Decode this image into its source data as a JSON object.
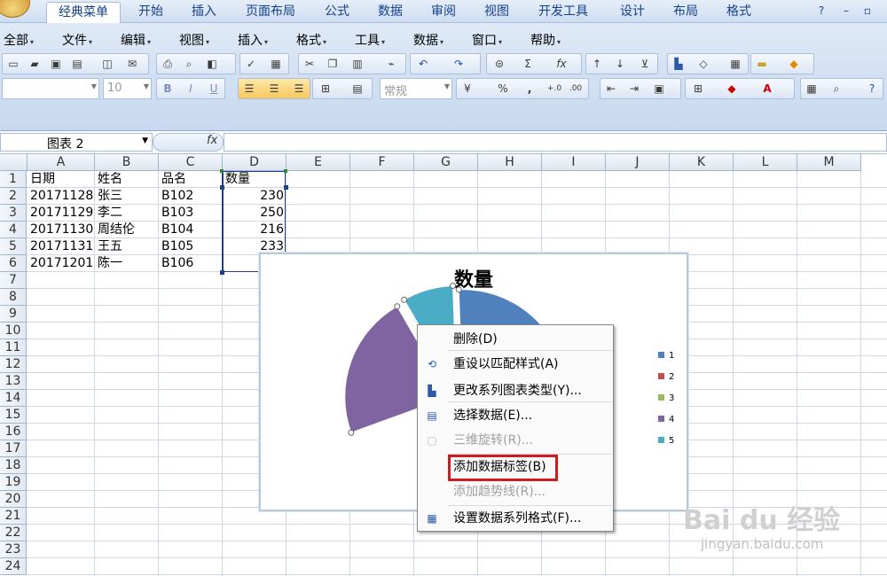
{
  "tabs": [
    {
      "label": "经典菜单",
      "active": true
    },
    {
      "label": "开始"
    },
    {
      "label": "插入"
    },
    {
      "label": "页面布局"
    },
    {
      "label": "公式"
    },
    {
      "label": "数据"
    },
    {
      "label": "审阅"
    },
    {
      "label": "视图"
    },
    {
      "label": "开发工具"
    },
    {
      "label": "设计"
    },
    {
      "label": "布局"
    },
    {
      "label": "格式"
    }
  ],
  "menubar": [
    "全部",
    "文件",
    "编辑",
    "视图",
    "插入",
    "格式",
    "工具",
    "数据",
    "窗口",
    "帮助"
  ],
  "toolbar": {
    "font_size": "10",
    "number_format": "常规"
  },
  "formula_bar": {
    "name_box": "图表 2",
    "fx": "fx",
    "value": ""
  },
  "columns": [
    "A",
    "B",
    "C",
    "D",
    "E",
    "F",
    "G",
    "H",
    "I",
    "J",
    "K",
    "L",
    "M"
  ],
  "rows": [
    "1",
    "2",
    "3",
    "4",
    "5",
    "6",
    "7",
    "8",
    "9",
    "10",
    "11",
    "12",
    "13",
    "14",
    "15",
    "16",
    "17",
    "18",
    "19",
    "20",
    "21",
    "22",
    "23",
    "24"
  ],
  "sheet": {
    "headers": [
      "日期",
      "姓名",
      "品名",
      "数量"
    ],
    "data": [
      [
        "20171128",
        "张三",
        "B102",
        "230"
      ],
      [
        "20171129",
        "李二",
        "B103",
        "250"
      ],
      [
        "20171130",
        "周结伦",
        "B104",
        "216"
      ],
      [
        "20171131",
        "王五",
        "B105",
        "233"
      ],
      [
        "20171201",
        "陈一",
        "B106",
        ""
      ]
    ]
  },
  "chart_data": {
    "type": "pie",
    "title": "数量",
    "categories": [
      "1",
      "2",
      "3",
      "4",
      "5"
    ],
    "legend_position": "right",
    "colors": [
      "#4f81bd",
      "#c0504d",
      "#9bbb59",
      "#8064a2",
      "#4bacc6"
    ]
  },
  "context_menu": [
    {
      "label": "删除(D)",
      "disabled": false,
      "icon": "none"
    },
    {
      "label": "重设以匹配样式(A)",
      "disabled": false,
      "icon": "reset-style-icon"
    },
    {
      "label": "更改系列图表类型(Y)...",
      "disabled": false,
      "icon": "chart-type-icon"
    },
    {
      "label": "选择数据(E)...",
      "disabled": false,
      "icon": "select-data-icon"
    },
    {
      "label": "三维旋转(R)...",
      "disabled": true,
      "icon": "rotate-3d-icon"
    },
    {
      "label": "添加数据标签(B)",
      "disabled": false,
      "icon": "none",
      "highlighted": true
    },
    {
      "label": "添加趋势线(R)...",
      "disabled": true,
      "icon": "none"
    },
    {
      "label": "设置数据系列格式(F)...",
      "disabled": false,
      "icon": "format-series-icon"
    }
  ],
  "watermark": {
    "logo": "Bai du 经验",
    "url": "jingyan.baidu.com"
  }
}
